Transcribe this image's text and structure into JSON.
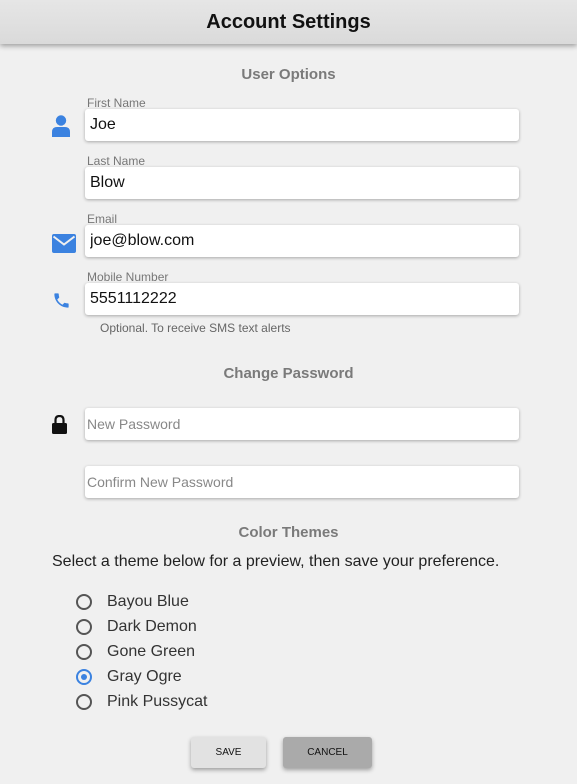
{
  "header": {
    "title": "Account Settings"
  },
  "user_options": {
    "title": "User Options",
    "first_name": {
      "label": "First Name",
      "value": "Joe",
      "icon": "user-icon"
    },
    "last_name": {
      "label": "Last Name",
      "value": "Blow"
    },
    "email": {
      "label": "Email",
      "value": "joe@blow.com",
      "icon": "envelope-icon"
    },
    "mobile": {
      "label": "Mobile Number",
      "value": "5551112222",
      "icon": "phone-icon",
      "hint": "Optional. To receive SMS text alerts"
    }
  },
  "change_password": {
    "title": "Change Password",
    "icon": "lock-icon",
    "new_placeholder": "New Password",
    "confirm_placeholder": "Confirm New Password"
  },
  "color_themes": {
    "title": "Color Themes",
    "intro": "Select a theme below for a preview, then save your preference.",
    "options": [
      "Bayou Blue",
      "Dark Demon",
      "Gone Green",
      "Gray Ogre",
      "Pink Pussycat"
    ],
    "selected": "Gray Ogre"
  },
  "buttons": {
    "save": "SAVE",
    "cancel": "CANCEL"
  },
  "colors": {
    "accent": "#3b82e0",
    "icon_blue": "#3b82e0",
    "header_bg": "#dadada"
  }
}
